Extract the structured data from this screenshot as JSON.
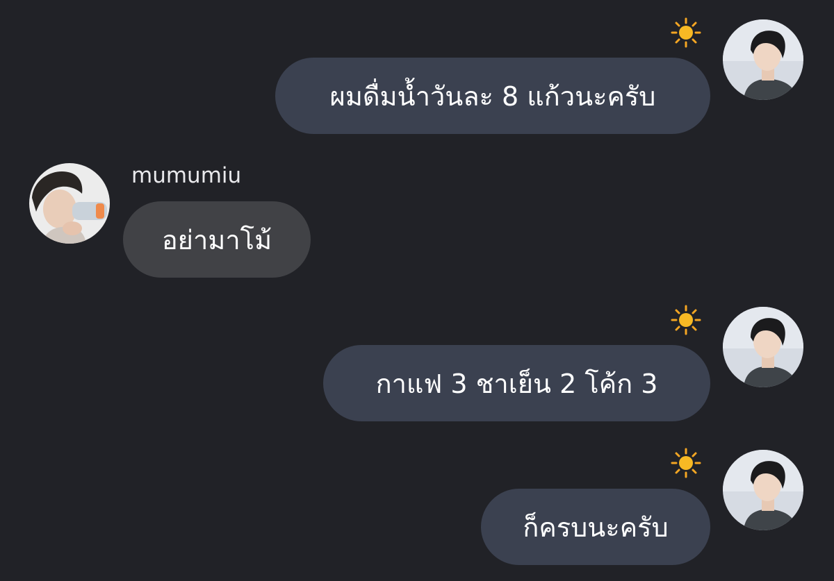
{
  "conversation": {
    "messages": [
      {
        "direction": "outgoing",
        "text": "ผมดื่มน้ำวันละ 8 แก้วนะครับ",
        "reaction_icon": "sun-emoji"
      },
      {
        "direction": "incoming",
        "sender": "mumumiu",
        "text": "อย่ามาโม้"
      },
      {
        "direction": "outgoing",
        "text": "กาแฟ 3 ชาเย็น 2 โค้ก 3",
        "reaction_icon": "sun-emoji"
      },
      {
        "direction": "outgoing",
        "text": "ก็ครบนะครับ",
        "reaction_icon": "sun-emoji"
      }
    ]
  },
  "colors": {
    "background": "#212227",
    "outgoing_bubble": "#3b4150",
    "incoming_bubble": "#414246",
    "text": "#ffffff",
    "sun": "#f7b924"
  }
}
